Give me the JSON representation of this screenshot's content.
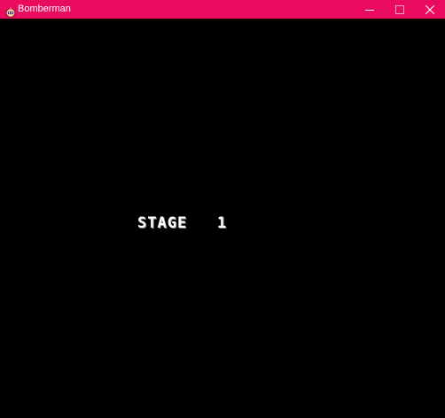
{
  "window": {
    "title": "Bomberman",
    "titlebar_color": "#ea0b5f",
    "icon": "bomberman-head-icon",
    "controls": {
      "minimize_icon": "minimize-icon",
      "maximize_icon": "maximize-icon",
      "close_icon": "close-icon"
    }
  },
  "game": {
    "background_color": "#000000",
    "stage_label": "STAGE",
    "stage_number": "1",
    "stage_text_color": "#ffffff"
  }
}
